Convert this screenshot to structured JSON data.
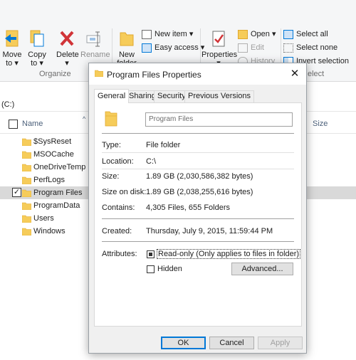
{
  "ribbon": {
    "move_to": "Move to",
    "copy_to": "Copy to",
    "delete": "Delete",
    "rename": "Rename",
    "new_folder": "New folder",
    "new_item": "New item",
    "easy_access": "Easy access",
    "properties": "Properties",
    "open": "Open",
    "edit": "Edit",
    "history": "History",
    "select_all": "Select all",
    "select_none": "Select none",
    "invert_selection": "Invert selection",
    "group_organize": "Organize",
    "group_select_partial": "elect"
  },
  "address": "(C:)",
  "columns": {
    "name": "Name",
    "size": "Size"
  },
  "files": [
    {
      "name": "$SysReset",
      "selected": false
    },
    {
      "name": "MSOCache",
      "selected": false
    },
    {
      "name": "OneDriveTemp",
      "selected": false
    },
    {
      "name": "PerfLogs",
      "selected": false
    },
    {
      "name": "Program Files",
      "selected": true
    },
    {
      "name": "ProgramData",
      "selected": false
    },
    {
      "name": "Users",
      "selected": false
    },
    {
      "name": "Windows",
      "selected": false
    }
  ],
  "dialog": {
    "title": "Program Files Properties",
    "close": "✕",
    "tabs": [
      "General",
      "Sharing",
      "Security",
      "Previous Versions"
    ],
    "folder_name": "Program Files",
    "fields": {
      "type_label": "Type:",
      "type_value": "File folder",
      "location_label": "Location:",
      "location_value": "C:\\",
      "size_label": "Size:",
      "size_value": "1.89 GB (2,030,586,382 bytes)",
      "size_on_disk_label": "Size on disk:",
      "size_on_disk_value": "1.89 GB (2,038,255,616 bytes)",
      "contains_label": "Contains:",
      "contains_value": "4,305 Files, 655 Folders",
      "created_label": "Created:",
      "created_value": "Thursday, July 9, 2015, 11:59:44 PM",
      "attributes_label": "Attributes:",
      "readonly_label": "Read-only (Only applies to files in folder)",
      "hidden_label": "Hidden",
      "advanced_button": "Advanced..."
    },
    "buttons": {
      "ok": "OK",
      "cancel": "Cancel",
      "apply": "Apply"
    }
  },
  "colors": {
    "folder": "#f6cc5a",
    "folder_dark": "#e0a82e",
    "accent": "#0078d7",
    "delete_red": "#d13438"
  }
}
